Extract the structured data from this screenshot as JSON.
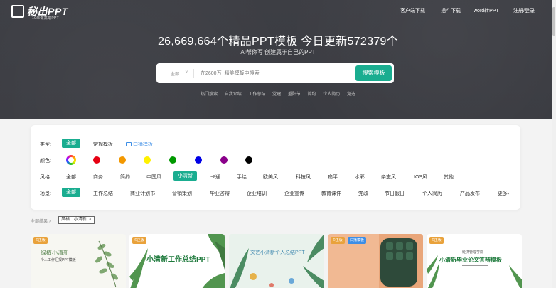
{
  "header": {
    "logo_text": "秘出PPT",
    "logo_sub": "— 10年做高端PPT —",
    "nav": [
      "客户端下载",
      "插件下载",
      "word转PPT",
      "注册/登录"
    ]
  },
  "hero": {
    "headline": "26,669,664个精品PPT模板 今日更新572379个",
    "subline": "AI帮你写 创建属于自己的PPT",
    "search_scope": "全部",
    "search_placeholder": "在2600万+精美模板中搜索",
    "search_button": "搜索模板",
    "hot_label": "热门搜索",
    "hot_terms": [
      "自我介绍",
      "工作总结",
      "党建",
      "重阳节",
      "简约",
      "个人简历",
      "竞选"
    ]
  },
  "filters": {
    "type": {
      "label": "类型:",
      "options": [
        "全部",
        "常规模板",
        "口播模板"
      ],
      "active": 0
    },
    "color": {
      "label": "颜色:",
      "colors": [
        "multi",
        "#e60012",
        "#f39800",
        "#fff100",
        "#009900",
        "#0000e6",
        "#8a008a",
        "#000000"
      ]
    },
    "style": {
      "label": "风格:",
      "options": [
        "全部",
        "商务",
        "简约",
        "中国风",
        "小清新",
        "卡通",
        "手绘",
        "欧美风",
        "科技风",
        "扁平",
        "水彩",
        "杂志风",
        "IOS风",
        "其他"
      ],
      "active": 4
    },
    "scene": {
      "label": "场景:",
      "options": [
        "全部",
        "工作总结",
        "商业计划书",
        "营销策划",
        "毕业答辩",
        "企业培训",
        "企业宣传",
        "教育课件",
        "党政",
        "节日假日",
        "个人简历",
        "产品发布",
        "更多›"
      ],
      "active": 0
    }
  },
  "crumb": {
    "text": "全部结果 >",
    "tag": "风格：小清新",
    "tag_close": "×"
  },
  "cards": [
    {
      "badge": "©正版",
      "title": "绿植小清新",
      "subtitle": "个人工作汇报PPT模板",
      "bg": "#f7f7f2",
      "accent": "#5f8a57"
    },
    {
      "badge": "©正版",
      "title": "小清新工作总结PPT",
      "subtitle": "",
      "bg": "#ffffff",
      "accent": "#1e7a3c"
    },
    {
      "badge": "",
      "title": "文艺小清新个人总结PPT",
      "subtitle": "",
      "bg": "#e9f2ec",
      "accent": "#4a8fb3"
    },
    {
      "badge": "©正版",
      "badge2": "口播模板",
      "title": "",
      "subtitle": "",
      "bg": "#f1b993",
      "accent": "#2e4a3a"
    },
    {
      "badge": "©正版",
      "title": "小清新毕业论文答辩模板",
      "subtitle": "经济管理学院",
      "bg": "#ffffff",
      "accent": "#1e7a3c"
    }
  ]
}
